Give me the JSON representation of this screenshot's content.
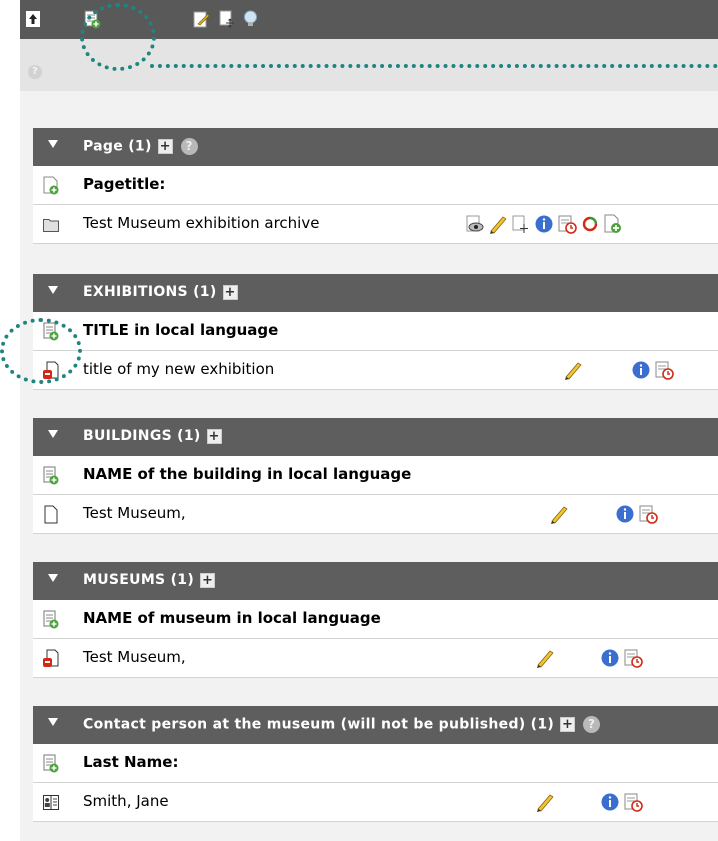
{
  "toolbar": {
    "icons": [
      "go-up-icon",
      "new-record-icon",
      "edit-page-icon",
      "move-page-icon",
      "lightbulb-icon"
    ]
  },
  "sections": [
    {
      "title": "Page (1)",
      "has_help": true,
      "field_label": "Pagetitle:",
      "record_label": "Test Museum exhibition archive",
      "record_icon": "folder-icon"
    },
    {
      "title": "EXHIBITIONS (1)",
      "has_help": false,
      "field_label": "TITLE in local language",
      "record_label": "title of my new exhibition",
      "record_icon": "exhibition-record-icon"
    },
    {
      "title": "BUILDINGS (1)",
      "has_help": false,
      "field_label": "NAME of the building in local language",
      "record_label": "Test Museum,",
      "record_icon": "blank-page-icon"
    },
    {
      "title": "MUSEUMS (1)",
      "has_help": false,
      "field_label": "NAME of museum in local language",
      "record_label": "Test Museum,",
      "record_icon": "museum-record-icon"
    },
    {
      "title": "Contact person at the museum (will not be published) (1)",
      "has_help": true,
      "field_label": "Last Name:",
      "record_label": "Smith, Jane",
      "record_icon": "address-card-icon"
    }
  ],
  "colors": {
    "highlight": "#1e8580",
    "header_bg": "#5e5e5e",
    "toolbar_bg": "#595959"
  }
}
